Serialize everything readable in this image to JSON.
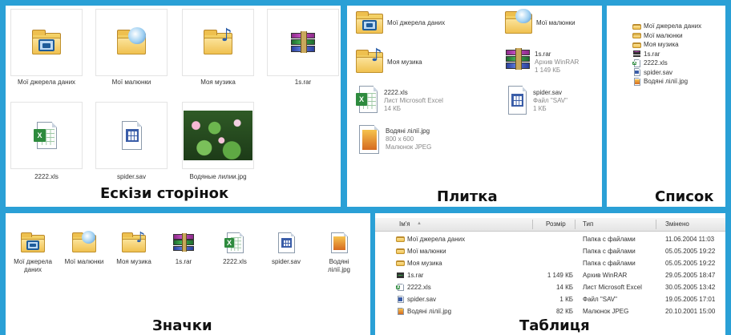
{
  "views": {
    "thumbnails": "Ескізи сторінок",
    "tiles": "Плитка",
    "list": "Список",
    "icons": "Значки",
    "details": "Таблиця"
  },
  "thumbnails": {
    "items": [
      {
        "label": "Мої джерела даних",
        "icon": "data-sources-folder-icon"
      },
      {
        "label": "Мої малюнки",
        "icon": "pictures-folder-icon"
      },
      {
        "label": "Моя музика",
        "icon": "music-folder-icon"
      },
      {
        "label": "1s.rar",
        "icon": "winrar-archive-icon"
      },
      {
        "label": "2222.xls",
        "icon": "excel-file-icon"
      },
      {
        "label": "spider.sav",
        "icon": "sav-file-icon"
      },
      {
        "label": "Водяные лилии.jpg",
        "icon": "water-lilies-photo"
      }
    ]
  },
  "tiles": {
    "items": [
      {
        "name": "Мої джерела даних",
        "line2": "",
        "line3": ""
      },
      {
        "name": "Мої малюнки",
        "line2": "",
        "line3": ""
      },
      {
        "name": "Моя музика",
        "line2": "",
        "line3": ""
      },
      {
        "name": "1s.rar",
        "line2": "Архив WinRAR",
        "line3": "1 149 КБ"
      },
      {
        "name": "2222.xls",
        "line2": "Лист Microsoft Excel",
        "line3": "14 КБ"
      },
      {
        "name": "spider.sav",
        "line2": "Файл \"SAV\"",
        "line3": "1 КБ"
      },
      {
        "name": "Водяні лілії.jpg",
        "line2": "800 x 600",
        "line3": "Малюнок JPEG"
      }
    ]
  },
  "list": {
    "items": [
      "Мої джерела даних",
      "Мої малюнки",
      "Моя музика",
      "1s.rar",
      "2222.xls",
      "spider.sav",
      "Водяні лілії.jpg"
    ]
  },
  "icons": {
    "items": [
      "Мої джерела даних",
      "Мої малюнки",
      "Моя музика",
      "1s.rar",
      "2222.xls",
      "spider.sav",
      "Водяні лілії.jpg"
    ]
  },
  "details": {
    "columns": {
      "name": "Ім'я",
      "sort_indicator": "▲",
      "size": "Розмір",
      "type": "Тип",
      "modified": "Змінено"
    },
    "rows": [
      {
        "name": "Мої джерела даних",
        "size": "",
        "type": "Папка с файлами",
        "modified": "11.06.2004 11:03"
      },
      {
        "name": "Мої малюнки",
        "size": "",
        "type": "Папка с файлами",
        "modified": "05.05.2005 19:22"
      },
      {
        "name": "Моя музика",
        "size": "",
        "type": "Папка с файлами",
        "modified": "05.05.2005 19:22"
      },
      {
        "name": "1s.rar",
        "size": "1 149 КБ",
        "type": "Архив WinRAR",
        "modified": "29.05.2005 18:47"
      },
      {
        "name": "2222.xls",
        "size": "14 КБ",
        "type": "Лист Microsoft Excel",
        "modified": "30.05.2005 13:42"
      },
      {
        "name": "spider.sav",
        "size": "1 КБ",
        "type": "Файл \"SAV\"",
        "modified": "19.05.2005 17:01"
      },
      {
        "name": "Водяні лілії.jpg",
        "size": "82 КБ",
        "type": "Малюнок JPEG",
        "modified": "20.10.2001 15:00"
      }
    ]
  },
  "colors": {
    "frame": "#2aa0d6",
    "folder": "#f0c150",
    "header": "#e4e4e4"
  }
}
